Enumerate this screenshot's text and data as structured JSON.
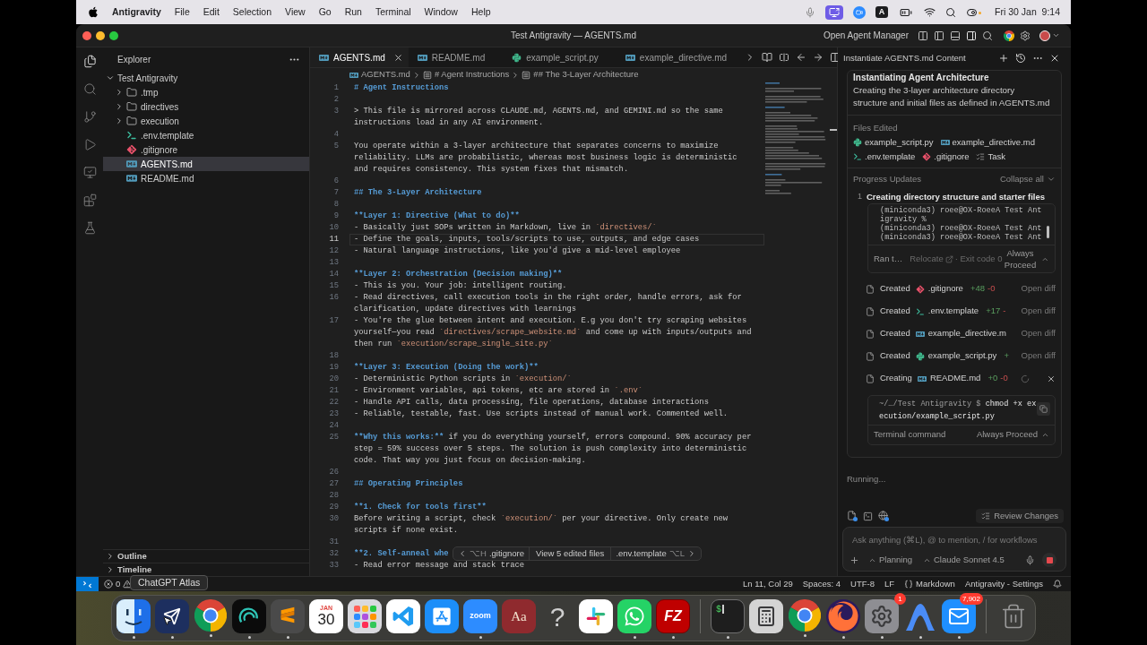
{
  "menu_bar": {
    "app_name": "Antigravity",
    "menus": [
      "File",
      "Edit",
      "Selection",
      "View",
      "Go",
      "Run",
      "Terminal",
      "Window",
      "Help"
    ],
    "input_source": "A",
    "clock": "Fri 30 Jan  9:14"
  },
  "window": {
    "title": "Test Antigravity — AGENTS.md",
    "agent_manager_button": "Open Agent Manager"
  },
  "activity_bar": [
    {
      "kind": "files",
      "selected": true
    },
    {
      "kind": "search",
      "selected": false
    },
    {
      "kind": "source-control",
      "selected": false
    },
    {
      "kind": "run",
      "selected": false
    },
    {
      "kind": "remote",
      "selected": false
    },
    {
      "kind": "extensions",
      "selected": false
    },
    {
      "kind": "testing",
      "selected": false
    }
  ],
  "explorer": {
    "title": "Explorer",
    "root": {
      "label": "Test Antigravity",
      "expanded": true,
      "children": [
        {
          "label": ".tmp",
          "kind": "folder",
          "expanded": false,
          "selected": false
        },
        {
          "label": "directives",
          "kind": "folder",
          "expanded": false,
          "selected": false
        },
        {
          "label": "execution",
          "kind": "folder",
          "expanded": false,
          "selected": false
        },
        {
          "label": ".env.template",
          "kind": "shell",
          "selected": false
        },
        {
          "label": ".gitignore",
          "kind": "git",
          "selected": false
        },
        {
          "label": "AGENTS.md",
          "kind": "markdown",
          "selected": true
        },
        {
          "label": "README.md",
          "kind": "markdown",
          "selected": false
        }
      ]
    },
    "sections": [
      {
        "label": "Outline",
        "expanded": false
      },
      {
        "label": "Timeline",
        "expanded": false
      }
    ]
  },
  "editor": {
    "tabs": [
      {
        "label": "AGENTS.md",
        "kind": "markdown",
        "selected": true
      },
      {
        "label": "README.md",
        "kind": "markdown",
        "selected": false
      },
      {
        "label": "example_script.py",
        "kind": "python",
        "selected": false
      },
      {
        "label": "example_directive.md",
        "kind": "markdown",
        "selected": false
      }
    ],
    "breadcrumbs": [
      {
        "label": "AGENTS.md",
        "kind": "markdown"
      },
      {
        "label": "# Agent Instructions",
        "kind": "symbol"
      },
      {
        "label": "## The 3-Layer Architecture",
        "kind": "symbol"
      }
    ],
    "lines": [
      {
        "number": "1",
        "kind": "heading",
        "current": false,
        "rows": [
          "# Agent Instructions"
        ]
      },
      {
        "number": "2",
        "kind": "text",
        "current": false
      },
      {
        "number": "3",
        "kind": "text",
        "current": false,
        "rows": [
          "> This file is mirrored across CLAUDE.md, AGENTS.md, and GEMINI.md so the same",
          "instructions load in any AI environment."
        ]
      },
      {
        "number": "4",
        "kind": "text",
        "current": false
      },
      {
        "number": "5",
        "kind": "text",
        "current": false,
        "rows": [
          "You operate within a 3-layer architecture that separates concerns to maximize",
          "reliability. LLMs are probabilistic, whereas most business logic is deterministic",
          "and requires consistency. This system fixes that mismatch."
        ]
      },
      {
        "number": "6",
        "kind": "text",
        "current": false
      },
      {
        "number": "7",
        "kind": "heading",
        "current": false,
        "rows": [
          "## The 3-Layer Architecture"
        ]
      },
      {
        "number": "8",
        "kind": "text",
        "current": false
      },
      {
        "number": "9",
        "kind": "text",
        "current": false,
        "rows": [
          "**Layer 1: Directive (What to do)**"
        ]
      },
      {
        "number": "10",
        "kind": "text",
        "current": false,
        "rows": [
          "- Basically just SOPs written in Markdown, live in `directives/`"
        ]
      },
      {
        "number": "11",
        "kind": "text",
        "current": true,
        "rows": [
          "- Define the goals, inputs, tools/scripts to use, outputs, and edge cases"
        ]
      },
      {
        "number": "12",
        "kind": "text",
        "current": false,
        "rows": [
          "- Natural language instructions, like you'd give a mid-level employee"
        ]
      },
      {
        "number": "13",
        "kind": "text",
        "current": false
      },
      {
        "number": "14",
        "kind": "text",
        "current": false,
        "rows": [
          "**Layer 2: Orchestration (Decision making)**"
        ]
      },
      {
        "number": "15",
        "kind": "text",
        "current": false,
        "rows": [
          "- This is you. Your job: intelligent routing."
        ]
      },
      {
        "number": "16",
        "kind": "text",
        "current": false,
        "rows": [
          "- Read directives, call execution tools in the right order, handle errors, ask for",
          "clarification, update directives with learnings"
        ]
      },
      {
        "number": "17",
        "kind": "text",
        "current": false,
        "rows": [
          "- You're the glue between intent and execution. E.g you don't try scraping websites",
          "yourself—you read `directives/scrape_website.md` and come up with inputs/outputs and",
          "then run `execution/scrape_single_site.py`"
        ]
      },
      {
        "number": "18",
        "kind": "text",
        "current": false
      },
      {
        "number": "19",
        "kind": "text",
        "current": false,
        "rows": [
          "**Layer 3: Execution (Doing the work)**"
        ]
      },
      {
        "number": "20",
        "kind": "text",
        "current": false,
        "rows": [
          "- Deterministic Python scripts in `execution/`"
        ]
      },
      {
        "number": "21",
        "kind": "text",
        "current": false,
        "rows": [
          "- Environment variables, api tokens, etc are stored in `.env`"
        ]
      },
      {
        "number": "22",
        "kind": "text",
        "current": false,
        "rows": [
          "- Handle API calls, data processing, file operations, database interactions"
        ]
      },
      {
        "number": "23",
        "kind": "text",
        "current": false,
        "rows": [
          "- Reliable, testable, fast. Use scripts instead of manual work. Commented well."
        ]
      },
      {
        "number": "24",
        "kind": "text",
        "current": false
      },
      {
        "number": "25",
        "kind": "text",
        "current": false,
        "rows": [
          "**Why this works:** if you do everything yourself, errors compound. 90% accuracy per",
          "step = 59% success over 5 steps. The solution is push complexity into deterministic",
          "code. That way you just focus on decision-making."
        ]
      },
      {
        "number": "26",
        "kind": "text",
        "current": false
      },
      {
        "number": "27",
        "kind": "heading",
        "current": false,
        "rows": [
          "## Operating Principles"
        ]
      },
      {
        "number": "28",
        "kind": "text",
        "current": false
      },
      {
        "number": "29",
        "kind": "text",
        "current": false,
        "rows": [
          "**1. Check for tools first**"
        ]
      },
      {
        "number": "30",
        "kind": "text",
        "current": false,
        "rows": [
          "Before writing a script, check `execution/` per your directive. Only create new",
          "scripts if none exist."
        ]
      },
      {
        "number": "31",
        "kind": "text",
        "current": false
      },
      {
        "number": "32",
        "kind": "text",
        "current": false,
        "rows": [
          "**2. Self-anneal whe"
        ]
      },
      {
        "number": "33",
        "kind": "text",
        "current": false,
        "rows": [
          "- Read error message and stack trace"
        ]
      }
    ],
    "edited_files_bar": {
      "previous_shortcut": "⌥H",
      "previous_file": ".gitignore",
      "summary": "View 5 edited files",
      "next_file": ".env.template",
      "next_shortcut": "⌥L"
    }
  },
  "agent_panel": {
    "title": "Instantiate AGENTS.md Content",
    "task": {
      "title": "Instantiating Agent Architecture",
      "description_rows": [
        "Creating the 3-layer architecture directory",
        "structure and initial files as defined in AGENTS.md"
      ]
    },
    "files_edited": {
      "label": "Files Edited",
      "files": [
        {
          "name": "example_script.py",
          "kind": "python"
        },
        {
          "name": "example_directive.md",
          "kind": "markdown"
        },
        {
          "name": ".env.template",
          "kind": "shell"
        },
        {
          "name": ".gitignore",
          "kind": "git"
        },
        {
          "name": "Task",
          "kind": "task"
        }
      ]
    },
    "progress": {
      "label": "Progress Updates",
      "collapse": "Collapse all",
      "steps": [
        {
          "number": "1",
          "title": "Creating directory structure and starter files"
        }
      ]
    },
    "terminal_output": {
      "lines": [
        "(miniconda3) roee@OX-RoeeA Test Ant",
        "igravity %",
        "(miniconda3) roee@OX-RoeeA Test Ant",
        "(miniconda3) roee@OX-RoeeA Test Ant"
      ],
      "ran": "Ran t…",
      "relocate": "Relocate",
      "exit": "· Exit code 0",
      "action": "Always Proceed"
    },
    "file_actions": [
      {
        "verb": "Created",
        "name": ".gitignore",
        "kind": "git",
        "added": "+48",
        "removed": "-0",
        "link": "Open diff",
        "in_progress": false
      },
      {
        "verb": "Created",
        "name": ".env.template",
        "kind": "shell",
        "added": "+17",
        "removed": "-",
        "link": "Open diff",
        "in_progress": false
      },
      {
        "verb": "Created",
        "name": "example_directive.m",
        "kind": "markdown",
        "link": "Open diff",
        "in_progress": false
      },
      {
        "verb": "Created",
        "name": "example_script.py",
        "kind": "python",
        "added": "+",
        "link": "Open diff",
        "in_progress": false
      },
      {
        "verb": "Creating",
        "name": "README.md",
        "kind": "markdown",
        "added": "+0",
        "removed": "-0",
        "in_progress": true
      }
    ],
    "command": {
      "prompt": "~/…/Test Antigravity $",
      "rows": [
        "chmod +x ex",
        "ecution/example_script.py"
      ],
      "label": "Terminal command",
      "action": "Always Proceed"
    },
    "status": "Running...",
    "review_button": "Review Changes",
    "input": {
      "placeholder": "Ask anything (⌘L), @ to mention, / for workflows",
      "mode": "Planning",
      "model": "Claude Sonnet 4.5"
    }
  },
  "status_bar": {
    "errors": "0",
    "cursor": "Ln 11, Col 29",
    "indentation": "Spaces: 4",
    "encoding": "UTF-8",
    "line_ending": "LF",
    "language": "Markdown",
    "settings": "Antigravity - Settings"
  },
  "tooltip": "ChatGPT Atlas",
  "dock": [
    {
      "kind": "face",
      "running": true
    },
    {
      "kind": "plane",
      "running": true
    },
    {
      "kind": "ball",
      "running": true
    },
    {
      "kind": "swirl",
      "running": true
    },
    {
      "kind": "stripes",
      "running": true
    },
    {
      "kind": "calendar",
      "month": "JAN",
      "day": "30",
      "running": false
    },
    {
      "kind": "grid",
      "running": false
    },
    {
      "kind": "ribbon",
      "running": false
    },
    {
      "kind": "a-shape",
      "running": false
    },
    {
      "kind": "wordmark",
      "glyph": "zoom",
      "running": true
    },
    {
      "kind": "book",
      "glyph": "Aa",
      "running": false
    },
    {
      "kind": "question",
      "glyph": "?",
      "running": false
    },
    {
      "kind": "hash",
      "running": false
    },
    {
      "kind": "bubble",
      "running": true
    },
    {
      "kind": "letters",
      "glyph": "FZ",
      "running": true
    },
    {
      "kind": "separator"
    },
    {
      "kind": "prompt",
      "glyph": "$",
      "running": true
    },
    {
      "kind": "calculator",
      "running": false
    },
    {
      "kind": "ball",
      "running": true
    },
    {
      "kind": "fox",
      "running": true
    },
    {
      "kind": "gear",
      "badge": "1",
      "running": true
    },
    {
      "kind": "arch",
      "running": true
    },
    {
      "kind": "envelope",
      "badge": "7,902",
      "running": true
    },
    {
      "kind": "separator"
    },
    {
      "kind": "trash",
      "running": false
    }
  ]
}
